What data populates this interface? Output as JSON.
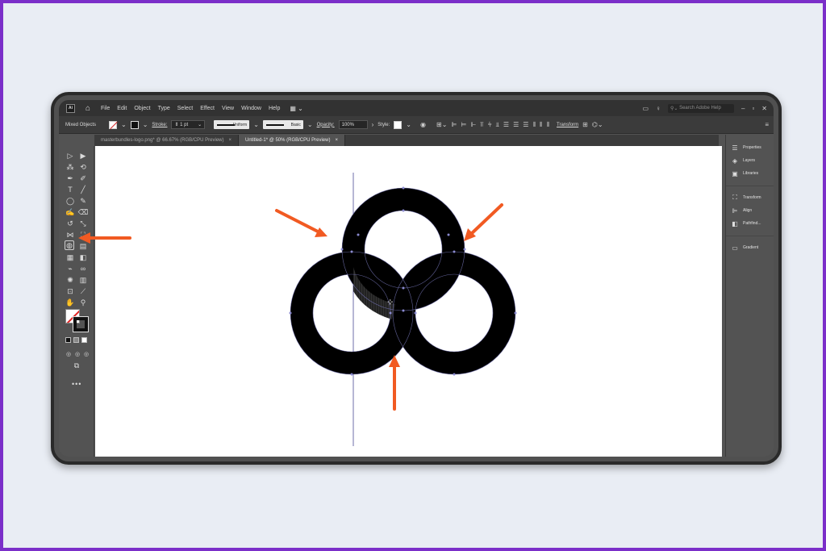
{
  "menubar": {
    "logo": "Ai",
    "items": [
      "File",
      "Edit",
      "Object",
      "Type",
      "Select",
      "Effect",
      "View",
      "Window",
      "Help"
    ],
    "search_placeholder": "Search Adobe Help"
  },
  "control_bar": {
    "selection_label": "Mixed Objects",
    "stroke_label": "Stroke:",
    "stroke_value": "1 pt",
    "profile_label": "Uniform",
    "brush_label": "Basic",
    "opacity_label": "Opacity:",
    "opacity_value": "100%",
    "style_label": "Style:",
    "transform_label": "Transform"
  },
  "tabs": [
    {
      "label": "masterbundles-logo.png* @ 66.67% (RGB/CPU Preview)",
      "active": false
    },
    {
      "label": "Untitled-1* @ 50% (RGB/CPU Preview)",
      "active": true
    }
  ],
  "panels": {
    "group1": [
      "Properties",
      "Layers",
      "Libraries"
    ],
    "group2": [
      "Transform",
      "Align",
      "Pathfind..."
    ],
    "group3": [
      "Gradient"
    ]
  },
  "colors": {
    "accent_arrow": "#f15a22",
    "frame": "#7b2fc9",
    "ring": "#000000",
    "guide": "#6c6ca8"
  },
  "icons": {
    "highlighted_tool": "shape-builder-icon",
    "home": "home-icon",
    "search": "search-icon",
    "lightbulb": "lightbulb-icon"
  }
}
